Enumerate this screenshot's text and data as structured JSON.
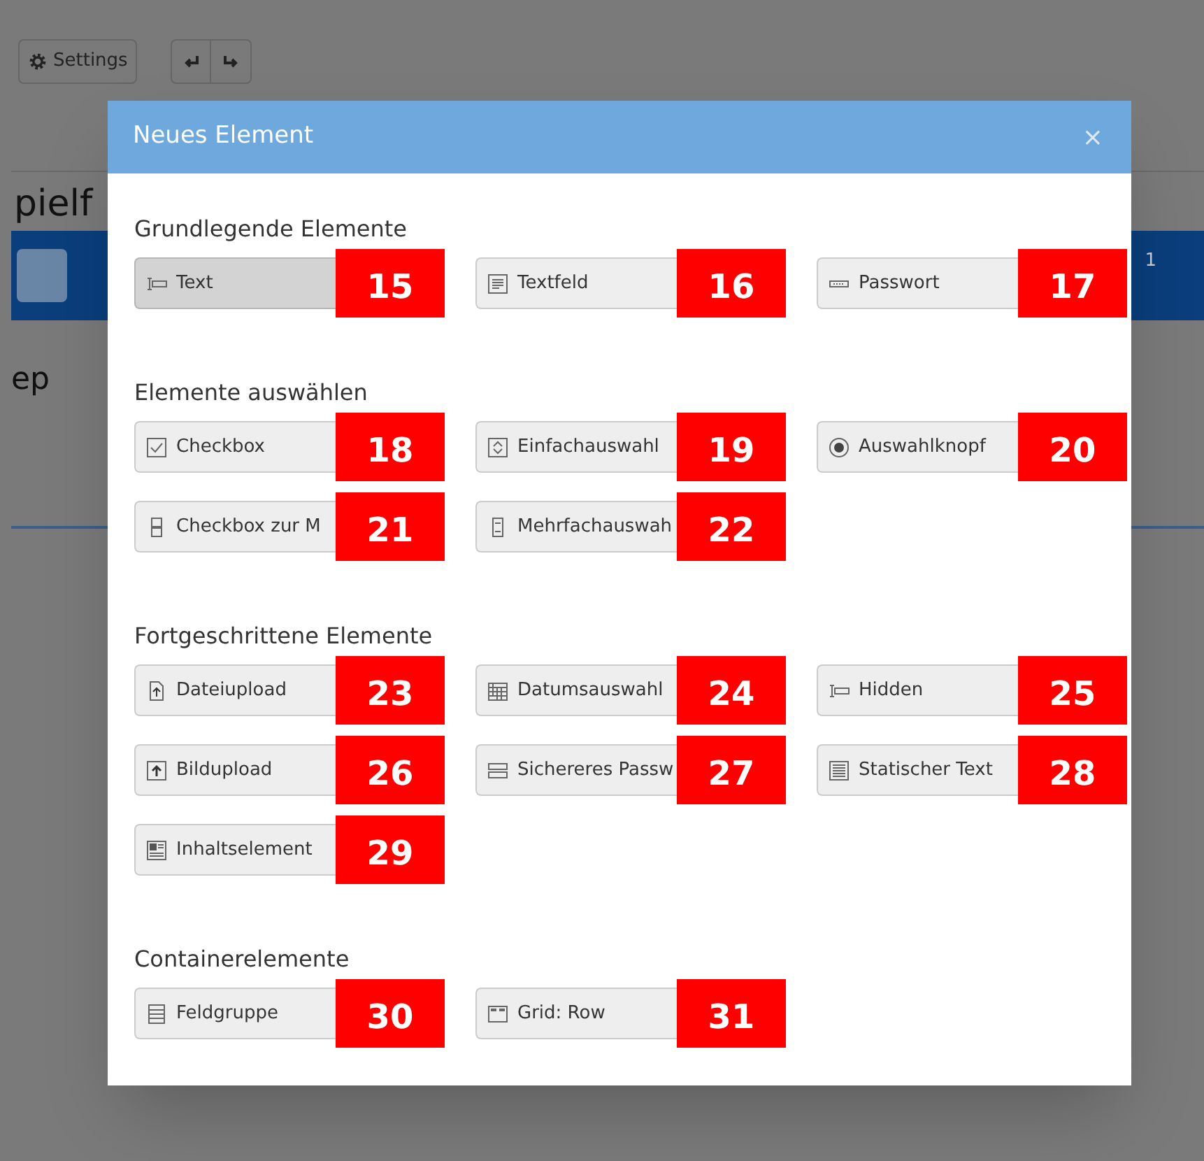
{
  "toolbar": {
    "settings_label": "Settings"
  },
  "page": {
    "title": "pielf",
    "blue_bar_count": "1",
    "subtitle": "ep"
  },
  "dialog": {
    "title": "Neues Element",
    "close": "×",
    "sections": [
      {
        "title": "Grundlegende Elemente",
        "items": [
          {
            "label": "Text",
            "badge": "15",
            "selected": true
          },
          {
            "label": "Textfeld",
            "badge": "16",
            "selected": false
          },
          {
            "label": "Passwort",
            "badge": "17",
            "selected": false
          }
        ]
      },
      {
        "title": "Elemente auswählen",
        "items": [
          {
            "label": "Checkbox",
            "badge": "18",
            "selected": false
          },
          {
            "label": "Einfachauswahl",
            "badge": "19",
            "selected": false
          },
          {
            "label": "Auswahlknopf",
            "badge": "20",
            "selected": false
          },
          {
            "label": "Checkbox zur M",
            "badge": "21",
            "selected": false
          },
          {
            "label": "Mehrfachauswah",
            "badge": "22",
            "selected": false
          }
        ]
      },
      {
        "title": "Fortgeschrittene Elemente",
        "items": [
          {
            "label": "Dateiupload",
            "badge": "23",
            "selected": false
          },
          {
            "label": "Datumsauswahl",
            "badge": "24",
            "selected": false
          },
          {
            "label": "Hidden",
            "badge": "25",
            "selected": false
          },
          {
            "label": "Bildupload",
            "badge": "26",
            "selected": false
          },
          {
            "label": "Sichereres Passw",
            "badge": "27",
            "selected": false
          },
          {
            "label": "Statischer Text",
            "badge": "28",
            "selected": false
          },
          {
            "label": "Inhaltselement",
            "badge": "29",
            "selected": false
          }
        ]
      },
      {
        "title": "Containerelemente",
        "items": [
          {
            "label": "Feldgruppe",
            "badge": "30",
            "selected": false
          },
          {
            "label": "Grid: Row",
            "badge": "31",
            "selected": false
          }
        ]
      }
    ]
  }
}
